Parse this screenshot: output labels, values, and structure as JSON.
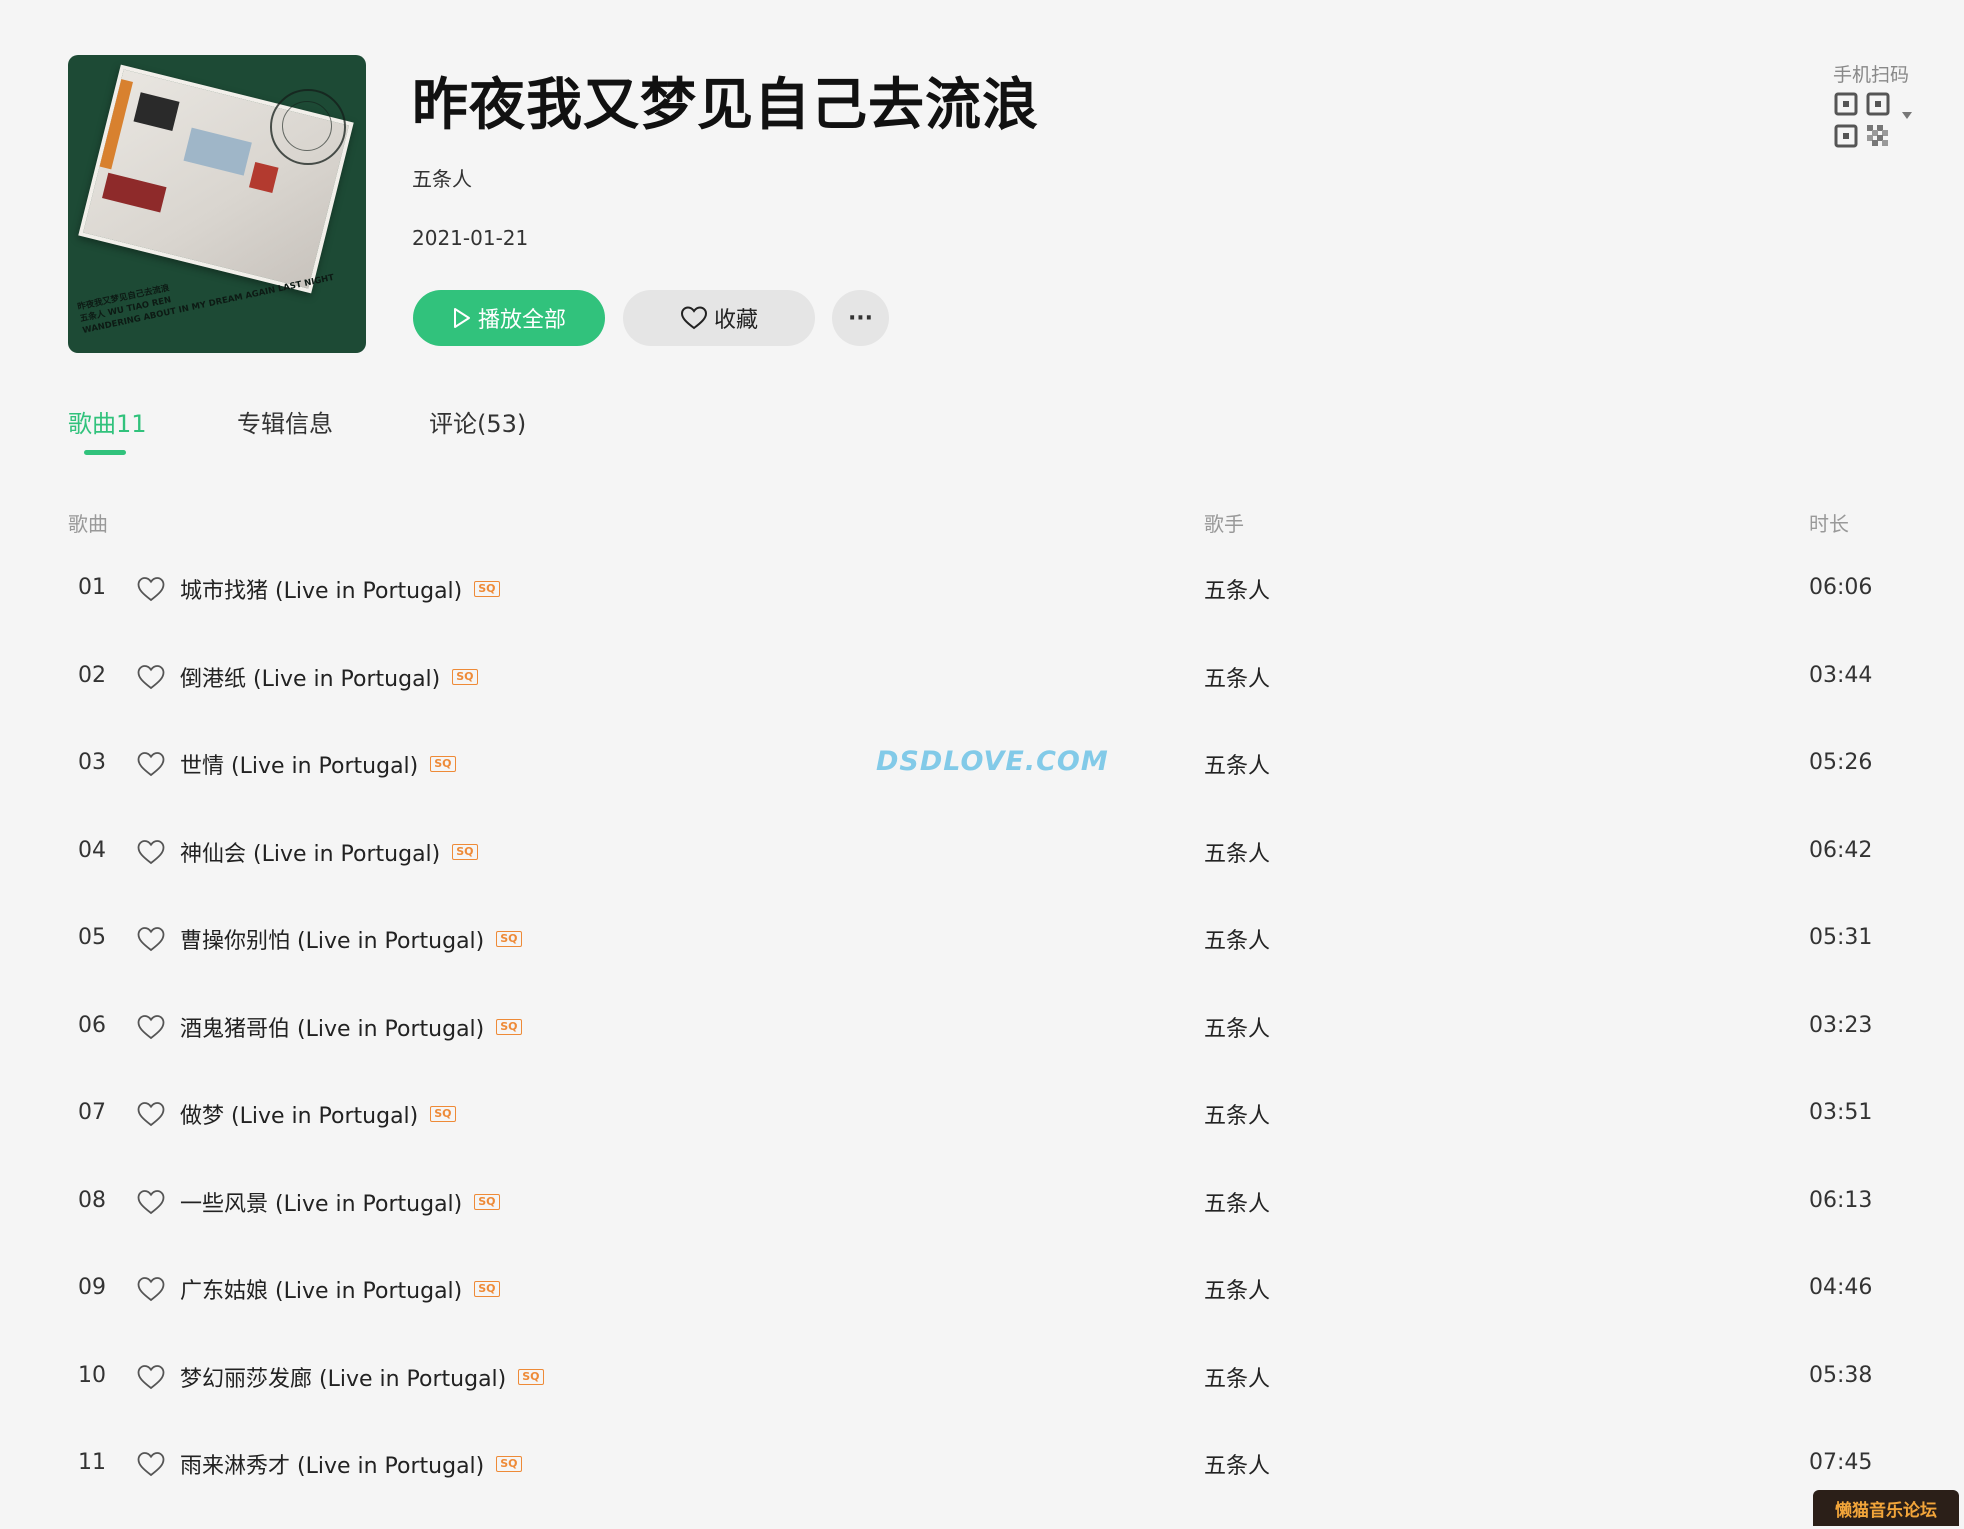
{
  "album": {
    "title": "昨夜我又梦见自己去流浪",
    "artist": "五条人",
    "date": "2021-01-21",
    "cover_caption_line1": "昨夜我又梦见自己去流浪",
    "cover_caption_line2": "五条人 WU TIAO REN",
    "cover_caption_line3": "WANDERING ABOUT IN MY DREAM AGAIN LAST NIGHT"
  },
  "actions": {
    "play_all": "播放全部",
    "favorite": "收藏",
    "more": "···"
  },
  "qr": {
    "label": "手机扫码"
  },
  "tabs": [
    {
      "label": "歌曲11"
    },
    {
      "label": "专辑信息"
    },
    {
      "label": "评论(53)"
    }
  ],
  "columns": {
    "song": "歌曲",
    "singer": "歌手",
    "duration": "时长"
  },
  "tracks": [
    {
      "num": "01",
      "title": "城市找猪 (Live in Portugal)",
      "singer": "五条人",
      "duration": "06:06"
    },
    {
      "num": "02",
      "title": "倒港纸 (Live in Portugal)",
      "singer": "五条人",
      "duration": "03:44"
    },
    {
      "num": "03",
      "title": "世情 (Live in Portugal)",
      "singer": "五条人",
      "duration": "05:26"
    },
    {
      "num": "04",
      "title": "神仙会 (Live in Portugal)",
      "singer": "五条人",
      "duration": "06:42"
    },
    {
      "num": "05",
      "title": "曹操你别怕 (Live in Portugal)",
      "singer": "五条人",
      "duration": "05:31"
    },
    {
      "num": "06",
      "title": "酒鬼猪哥伯 (Live in Portugal)",
      "singer": "五条人",
      "duration": "03:23"
    },
    {
      "num": "07",
      "title": "做梦 (Live in Portugal)",
      "singer": "五条人",
      "duration": "03:51"
    },
    {
      "num": "08",
      "title": "一些风景 (Live in Portugal)",
      "singer": "五条人",
      "duration": "06:13"
    },
    {
      "num": "09",
      "title": "广东姑娘 (Live in Portugal)",
      "singer": "五条人",
      "duration": "04:46"
    },
    {
      "num": "10",
      "title": "梦幻丽莎发廊 (Live in Portugal)",
      "singer": "五条人",
      "duration": "05:38"
    },
    {
      "num": "11",
      "title": "雨来淋秀才 (Live in Portugal)",
      "singer": "五条人",
      "duration": "07:45"
    }
  ],
  "quality_badge": "SQ",
  "watermark": "DSDLOVE.COM",
  "corner_badge": "懒猫音乐论坛",
  "colors": {
    "accent": "#31c27c",
    "sq": "#ee8a37",
    "background": "#f5f5f5"
  },
  "icons": {
    "play": "play-icon",
    "favorite": "heart-outline-icon",
    "qr": "qr-code-icon"
  }
}
